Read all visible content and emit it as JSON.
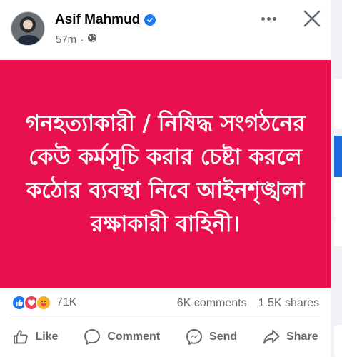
{
  "post": {
    "author": "Asif Mahmud",
    "time": "57m",
    "image_text": "গনহত্যাকারী / নিষিদ্ধ সংগঠনের কেউ কর্মসূচি করার চেষ্টা করলে কঠোর ব্যবস্থা নিবে আইনশৃঙ্খলা রক্ষাকারী বাহিনী।",
    "image_bg": "#e8114d"
  },
  "stats": {
    "reactions": "71K",
    "comments": "6K comments",
    "shares": "1.5K shares"
  },
  "actions": {
    "like": "Like",
    "comment": "Comment",
    "send": "Send",
    "share": "Share"
  },
  "icons": [
    "verified-icon",
    "globe-icon",
    "more-icon",
    "close-icon",
    "like-reaction-icon",
    "love-reaction-icon",
    "care-reaction-icon",
    "like-icon",
    "comment-icon",
    "send-icon",
    "share-icon"
  ]
}
